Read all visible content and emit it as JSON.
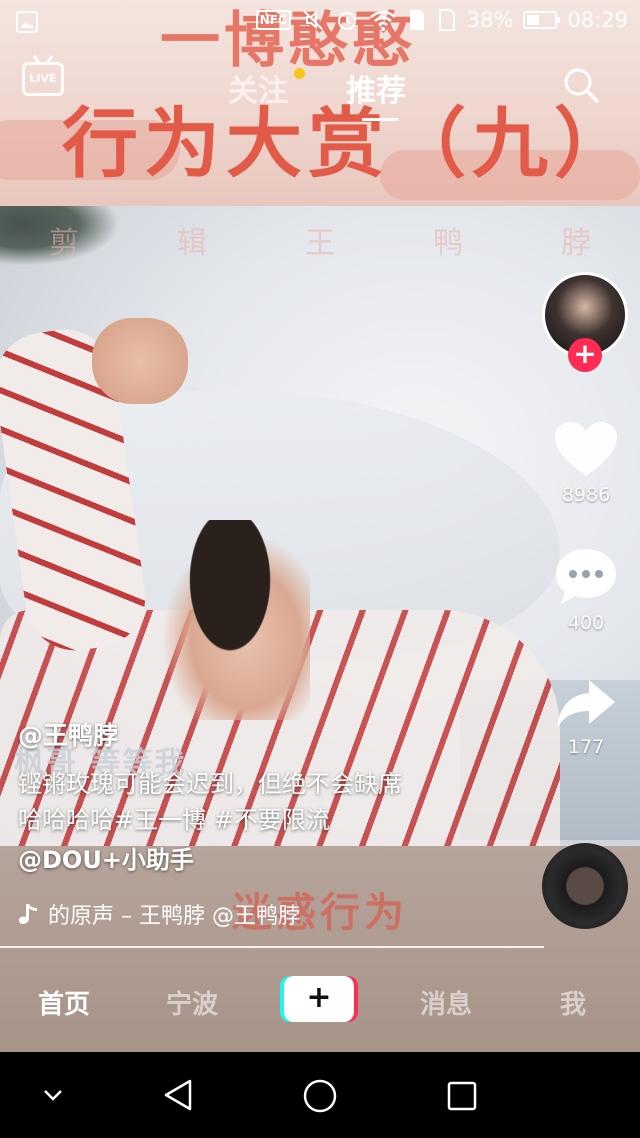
{
  "status_bar": {
    "nfc_label": "NFC",
    "battery_percent": "38%",
    "battery_level": 0.38,
    "time": "08:29",
    "icons": [
      "gallery-icon",
      "nfc-icon",
      "mute-icon",
      "alarm-icon",
      "wifi-icon",
      "sim1-icon",
      "sim2-icon",
      "battery-icon"
    ]
  },
  "video": {
    "banner_top_line1": "一博憨憨",
    "banner_top_line2": "行为大赏（九）",
    "watermark_chars": [
      "剪",
      "辑",
      "王",
      "鸭",
      "脖"
    ],
    "subtitle": "枫哥 等等我",
    "banner_bottom": "迷惑行为"
  },
  "top_nav": {
    "live_label": "LIVE",
    "follow_tab": "关注",
    "recommend_tab": "推荐",
    "accent_dot_color": "#f7c61b"
  },
  "actions": {
    "follow_plus": "+",
    "likes": "8986",
    "comments": "400",
    "shares": "177",
    "plus_color": "#fe2c55"
  },
  "caption": {
    "author": "@王鸭脖",
    "desc_line1": "铿锵玫瑰可能会迟到，但绝不会缺席",
    "desc_line2": "哈哈哈哈#王一博 #不要限流",
    "desc_line3": "@DOU+小助手",
    "music": "的原声 – 王鸭脖   @王鸭脖"
  },
  "bottom_nav": {
    "home": "首页",
    "local": "宁波",
    "create": "+",
    "messages": "消息",
    "me": "我"
  }
}
